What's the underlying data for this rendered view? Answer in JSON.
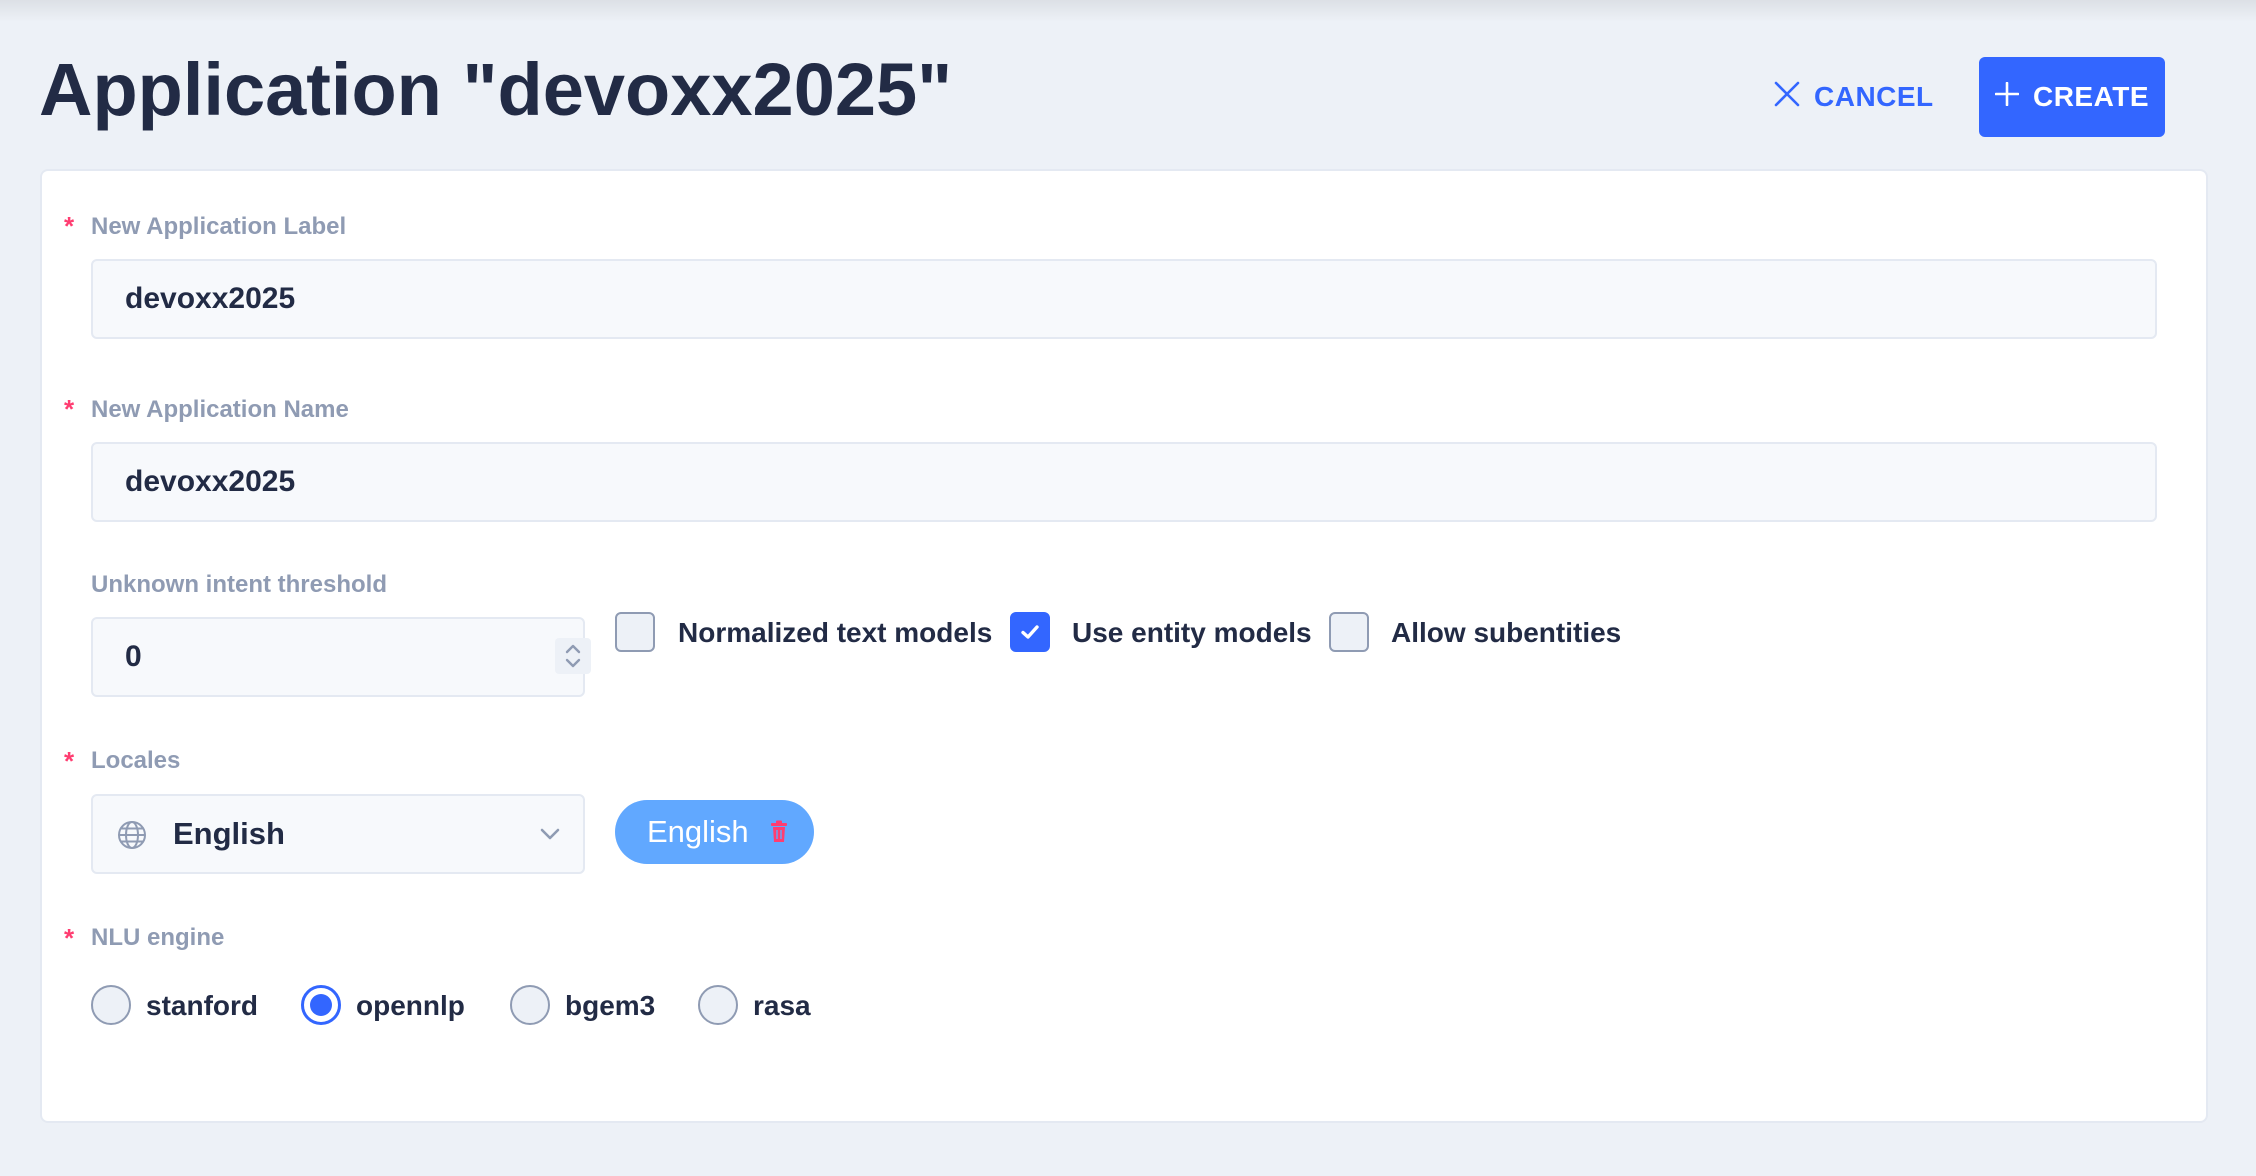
{
  "header": {
    "title": "Application \"devoxx2025\"",
    "cancel_label": "CANCEL",
    "create_label": "CREATE"
  },
  "form": {
    "required_marker": "*",
    "app_label": {
      "label": "New Application Label",
      "value": "devoxx2025"
    },
    "app_name": {
      "label": "New Application Name",
      "value": "devoxx2025"
    },
    "threshold": {
      "label": "Unknown intent threshold",
      "value": "0"
    },
    "options": [
      {
        "label": "Normalized text models",
        "checked": false
      },
      {
        "label": "Use entity models",
        "checked": true
      },
      {
        "label": "Allow subentities",
        "checked": false
      }
    ],
    "locales": {
      "label": "Locales",
      "selected": "English",
      "tags": [
        "English"
      ]
    },
    "nlu_engine": {
      "label": "NLU engine",
      "options": [
        "stanford",
        "opennlp",
        "bgem3",
        "rasa"
      ],
      "selected": "opennlp"
    }
  },
  "colors": {
    "accent": "#3366ff",
    "required": "#ff3d71",
    "label": "#8f9bb3",
    "tag": "#61a8ff",
    "text": "#222b45",
    "background": "#edf1f7"
  },
  "icons": {
    "cancel": "close-icon",
    "create": "plus-icon",
    "locale": "globe-icon",
    "select": "chevron-down-icon",
    "tag_remove": "trash-icon",
    "checked": "check-icon"
  }
}
